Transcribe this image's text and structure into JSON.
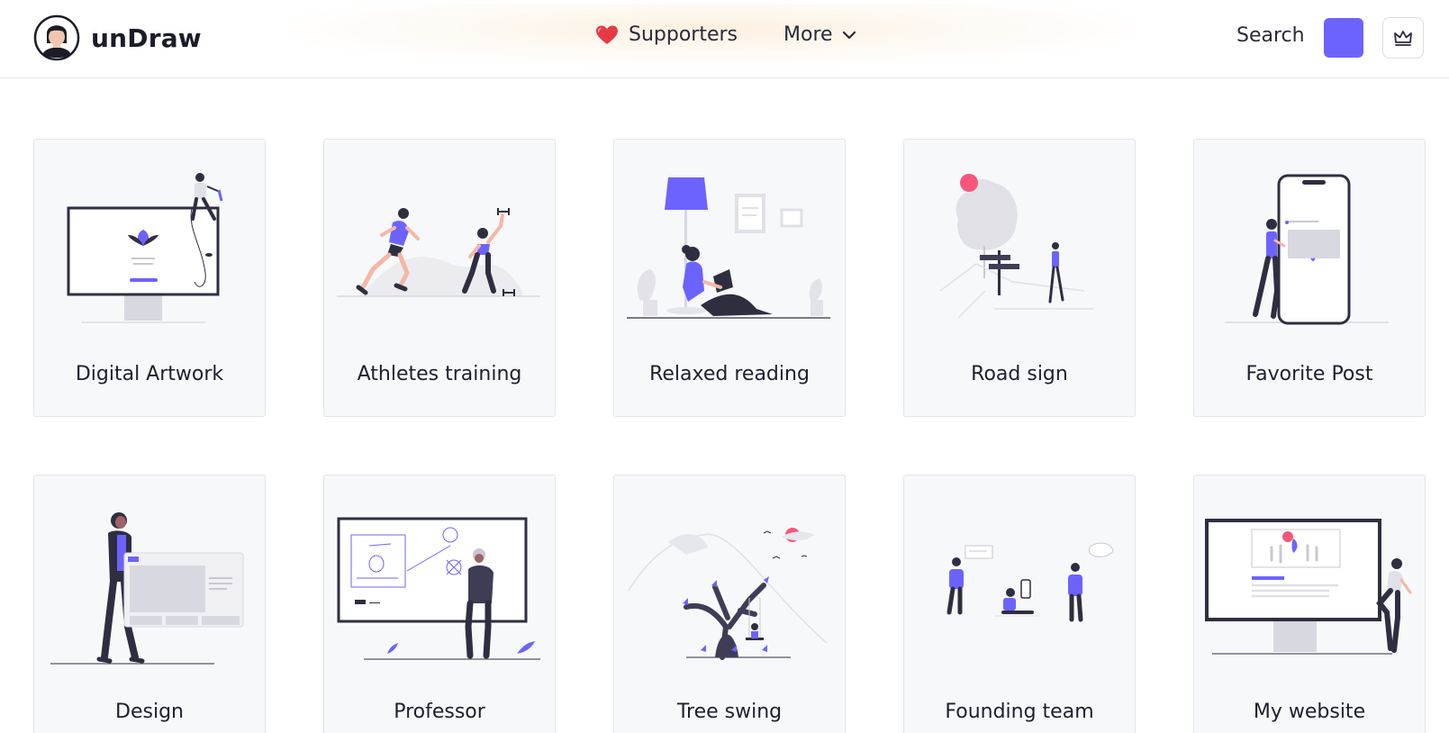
{
  "brand": {
    "name": "unDraw"
  },
  "nav": {
    "supporters_label": "Supporters",
    "more_label": "More"
  },
  "header_actions": {
    "search_label": "Search",
    "accent_color": "#6c63ff"
  },
  "illustrations": [
    {
      "title": "Digital Artwork",
      "icon": "monitor-illustration"
    },
    {
      "title": "Athletes training",
      "icon": "athletes-illustration"
    },
    {
      "title": "Relaxed reading",
      "icon": "reading-illustration"
    },
    {
      "title": "Road sign",
      "icon": "road-sign-illustration"
    },
    {
      "title": "Favorite Post",
      "icon": "phone-illustration"
    },
    {
      "title": "Design",
      "icon": "design-illustration"
    },
    {
      "title": "Professor",
      "icon": "professor-illustration"
    },
    {
      "title": "Tree swing",
      "icon": "tree-swing-illustration"
    },
    {
      "title": "Founding team",
      "icon": "team-illustration"
    },
    {
      "title": "My website",
      "icon": "website-illustration"
    }
  ],
  "colors": {
    "accent": "#6c63ff",
    "heart": "#e63946",
    "dark": "#2f2e41",
    "card_bg": "#f7f8fa"
  }
}
